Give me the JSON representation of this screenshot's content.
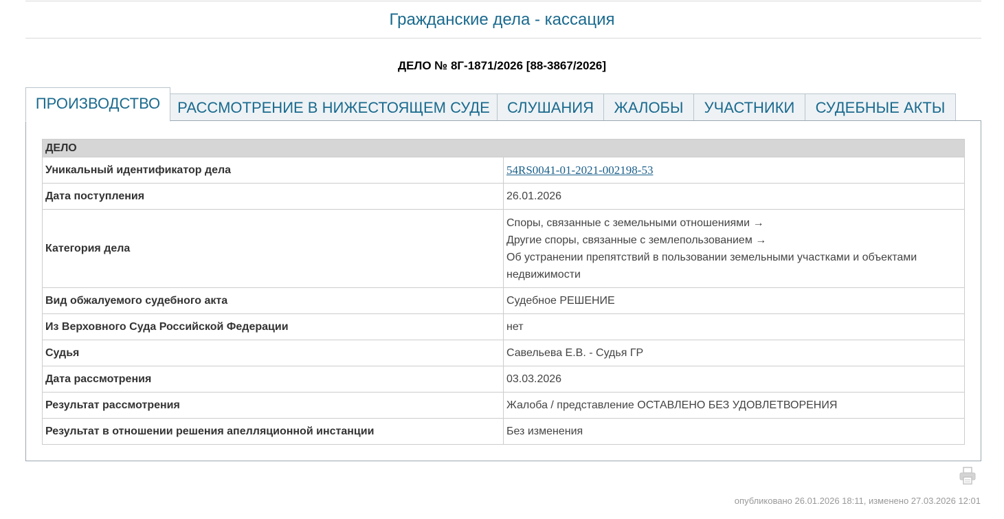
{
  "header": {
    "section_title": "Гражданские дела - кассация",
    "case_number": "ДЕЛО № 8Г-1871/2026 [88-3867/2026]"
  },
  "tabs": [
    {
      "label": "ПРОИЗВОДСТВО",
      "active": true
    },
    {
      "label": "РАССМОТРЕНИЕ В НИЖЕСТОЯЩЕМ СУДЕ",
      "active": false
    },
    {
      "label": "СЛУШАНИЯ",
      "active": false
    },
    {
      "label": "ЖАЛОБЫ",
      "active": false
    },
    {
      "label": "УЧАСТНИКИ",
      "active": false
    },
    {
      "label": "СУДЕБНЫЕ АКТЫ",
      "active": false
    }
  ],
  "case_table": {
    "group_header": "ДЕЛО",
    "rows": [
      {
        "label": "Уникальный идентификатор дела",
        "value": "54RS0041-01-2021-002198-53"
      },
      {
        "label": "Дата поступления",
        "value": "26.01.2026"
      },
      {
        "label": "Категория дела",
        "value_lines": [
          "Споры, связанные с земельными отношениями →",
          "Другие споры, связанные с землепользованием →",
          "Об устранении препятствий в пользовании земельными участками и объектами",
          "недвижимости"
        ]
      },
      {
        "label": "Вид обжалуемого судебного акта",
        "value": "Судебное РЕШЕНИЕ"
      },
      {
        "label": "Из Верховного Суда Российской Федерации",
        "value": "нет"
      },
      {
        "label": "Судья",
        "value": "Савельева Е.В. - Судья ГР"
      },
      {
        "label": "Дата рассмотрения",
        "value": "03.03.2026"
      },
      {
        "label": "Результат рассмотрения",
        "value": "Жалоба / представление ОСТАВЛЕНО БЕЗ УДОВЛЕТВОРЕНИЯ"
      },
      {
        "label": "Результат в отношении решения апелляционной инстанции",
        "value": "Без изменения"
      }
    ]
  },
  "footer": {
    "published_note": "опубликовано 26.01.2026 18:11, изменено 27.03.2026 12:01",
    "print_icon": "printer-icon"
  },
  "colors": {
    "accent": "#1a6a8e",
    "tab_background": "#eef2f5",
    "group_header_background": "#d6d6d6"
  }
}
